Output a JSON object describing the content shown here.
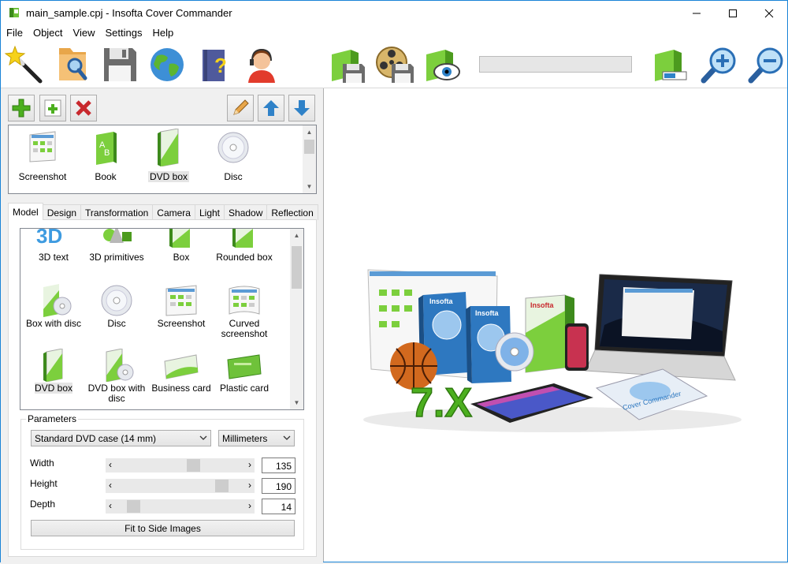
{
  "window": {
    "title": "main_sample.cpj - Insofta Cover Commander",
    "controls": {
      "minimize": "—",
      "maximize": "☐",
      "close": "✕"
    }
  },
  "menu": [
    "File",
    "Object",
    "View",
    "Settings",
    "Help"
  ],
  "toolbar": {
    "buttons": [
      "magic-wand-icon",
      "open-folder-icon",
      "save-icon",
      "web-icon",
      "help-book-icon",
      "support-icon",
      "save-image-icon",
      "save-animation-icon",
      "preview-icon",
      "render-settings-icon",
      "zoom-in-icon",
      "zoom-out-icon"
    ],
    "progress_percent": 0
  },
  "object_list": {
    "items": [
      {
        "label": "Screenshot",
        "selected": false
      },
      {
        "label": "Book",
        "selected": false
      },
      {
        "label": "DVD box",
        "selected": true
      },
      {
        "label": "Disc",
        "selected": false
      }
    ]
  },
  "tabs": [
    "Model",
    "Design",
    "Transformation",
    "Camera",
    "Light",
    "Shadow",
    "Reflection"
  ],
  "active_tab": "Model",
  "models": [
    {
      "label": "3D text",
      "icon": "3d-text-icon"
    },
    {
      "label": "3D primitives",
      "icon": "3d-primitives-icon"
    },
    {
      "label": "Box",
      "icon": "box-icon"
    },
    {
      "label": "Rounded box",
      "icon": "rounded-box-icon"
    },
    {
      "label": "Box with disc",
      "icon": "box-with-disc-icon"
    },
    {
      "label": "Disc",
      "icon": "disc-icon"
    },
    {
      "label": "Screenshot",
      "icon": "screenshot-icon"
    },
    {
      "label": "Curved screenshot",
      "icon": "curved-screenshot-icon"
    },
    {
      "label": "DVD box",
      "icon": "dvd-box-icon",
      "selected": true
    },
    {
      "label": "DVD box with disc",
      "icon": "dvd-box-with-disc-icon"
    },
    {
      "label": "Business card",
      "icon": "business-card-icon"
    },
    {
      "label": "Plastic card",
      "icon": "plastic-card-icon"
    }
  ],
  "parameters": {
    "legend": "Parameters",
    "preset": "Standard DVD case (14 mm)",
    "units": "Millimeters",
    "width": {
      "label": "Width",
      "value": "135",
      "level": 0.62
    },
    "height": {
      "label": "Height",
      "value": "190",
      "level": 0.88
    },
    "depth": {
      "label": "Depth",
      "value": "14",
      "level": 0.08
    },
    "fit_button": "Fit to Side Images"
  },
  "preview": {
    "texts": {
      "version": "7.X",
      "brand": "Insofta",
      "product": "Cover Commander"
    }
  },
  "colors": {
    "accent": "#1883d7",
    "green": "#4caf1f",
    "window_bg": "#f0f0f0"
  }
}
